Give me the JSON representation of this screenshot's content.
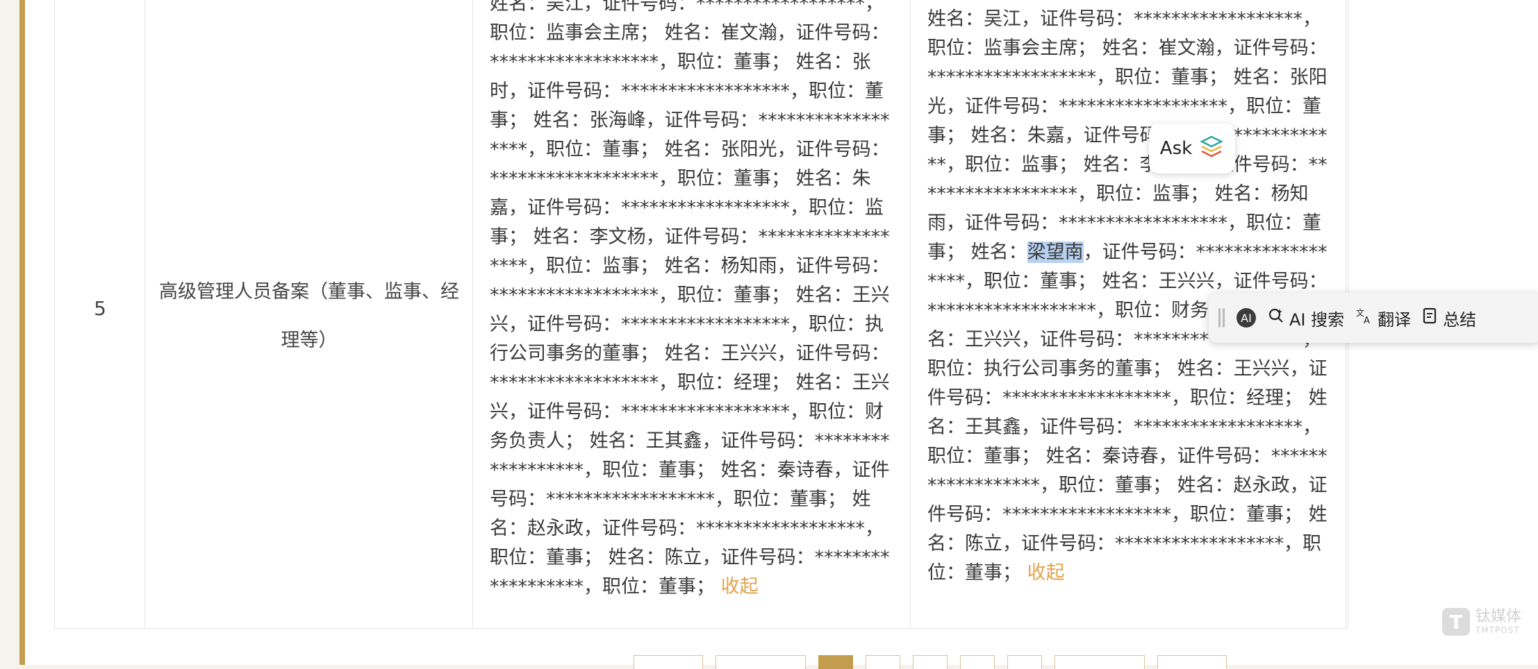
{
  "row": {
    "number": "5",
    "item": "高级管理人员备案（董事、监事、经理等）",
    "before_text": "姓名：吴江，证件号码：******************，职位：监事会主席； 姓名：崔文瀚，证件号码：******************，职位：董事； 姓名：张时，证件号码：******************，职位：董事； 姓名：张海峰，证件号码：******************，职位：董事； 姓名：张阳光，证件号码：******************，职位：董事； 姓名：朱嘉，证件号码：******************，职位：监事； 姓名：李文杨，证件号码：******************，职位：监事； 姓名：杨知雨，证件号码：******************，职位：董事； 姓名：王兴兴，证件号码：******************，职位：执行公司事务的董事； 姓名：王兴兴，证件号码：******************，职位：经理； 姓名：王兴兴，证件号码：******************，职位：财务负责人； 姓名：王其鑫，证件号码：******************，职位：董事； 姓名：秦诗春，证件号码：******************，职位：董事； 姓名：赵永政，证件号码：******************，职位：董事； 姓名：陈立，证件号码：******************，职位：董事；",
    "after_text_1": "姓名：吴江，证件号码：******************，职位：监事会主席； 姓名：崔文瀚，证件号码：******************，职位：董事； 姓名：张阳光，证件号码：******************，职位：董事； 姓名：朱嘉，证件号码：******************，职位：监事； 姓名：李文杨，证件号码：******************，职位：监事； 姓名：杨知雨，证件号码：******************，职位：董事； 姓名：",
    "after_highlight": "梁望南",
    "after_text_2": "，证件号码：******************，职位：董事； 姓名：王兴兴，证件号码：******************，职位：财务负责人； 姓名：王兴兴，证件号码：******************，职位：执行公司事务的董事； 姓名：王兴兴，证件号码：******************，职位：经理； 姓名：王其鑫，证件号码：******************，职位：董事； 姓名：秦诗春，证件号码：******************，职位：董事； 姓名：赵永政，证件号码：******************，职位：董事； 姓名：陈立，证件号码：******************，职位：董事；",
    "collapse_label": "收起"
  },
  "ask_popup": {
    "label": "Ask",
    "icon": "layers-logo-icon"
  },
  "selection_toolbar": {
    "avatar_label": "AI",
    "items": [
      {
        "label": "AI 搜索",
        "icon": "ai-search-icon"
      },
      {
        "label": "翻译",
        "icon": "translate-icon"
      },
      {
        "label": "总结",
        "icon": "summary-icon"
      }
    ]
  },
  "watermark": {
    "cn": "钛媒体",
    "en": "TMTPOST",
    "logo_letter": "T"
  },
  "colors": {
    "accent": "#c49c4e",
    "link": "#e2a24d",
    "highlight": "#b9d2f3"
  }
}
